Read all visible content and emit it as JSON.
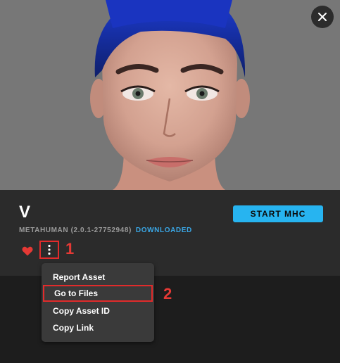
{
  "asset": {
    "title": "V",
    "version_label": "METAHUMAN (2.0.1-27752948)",
    "status_label": "DOWNLOADED"
  },
  "actions": {
    "start_label": "START MHC"
  },
  "icons": {
    "close": "close-icon",
    "favorite": "heart-icon",
    "more": "more-vertical-icon"
  },
  "menu": {
    "items": [
      {
        "label": "Report Asset"
      },
      {
        "label": "Go to Files"
      },
      {
        "label": "Copy Asset ID"
      },
      {
        "label": "Copy Link"
      }
    ]
  },
  "annotations": {
    "step1": "1",
    "step2": "2"
  },
  "colors": {
    "accent": "#27b4f0",
    "status": "#3aa7e6",
    "favorite": "#e53935",
    "annotation": "#e12b2b"
  }
}
